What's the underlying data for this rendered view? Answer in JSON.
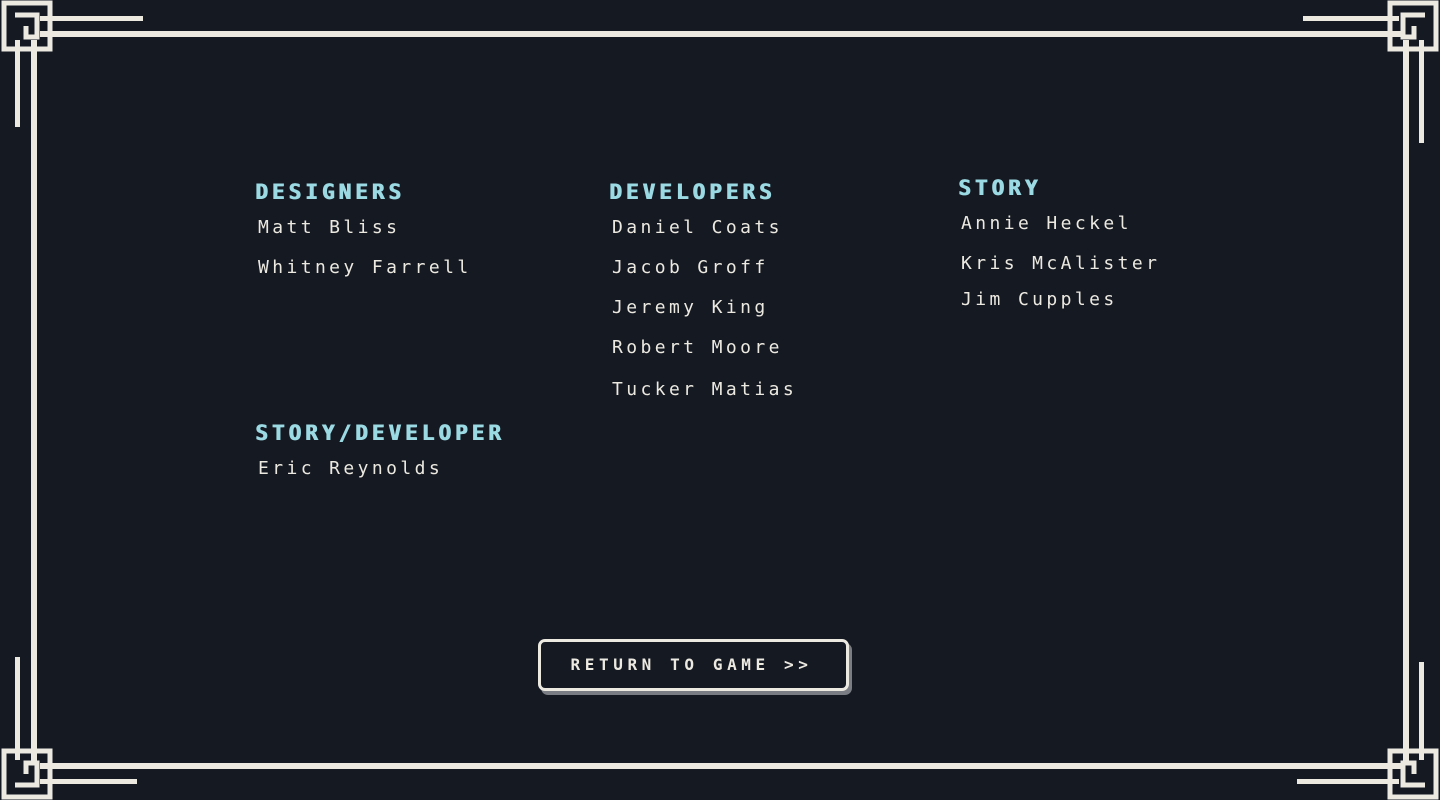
{
  "credits": {
    "designers": {
      "heading": "DESIGNERS",
      "names": [
        "Matt Bliss",
        "Whitney Farrell"
      ]
    },
    "developers": {
      "heading": "DEVELOPERS",
      "names": [
        "Daniel Coats",
        "Jacob Groff",
        "Jeremy King",
        "Robert Moore",
        "Tucker Matias"
      ]
    },
    "story": {
      "heading": "STORY",
      "names": [
        "Annie Heckel",
        "Kris McAlister",
        "Jim Cupples"
      ]
    },
    "story_developer": {
      "heading": "STORY/DEVELOPER",
      "names": [
        "Eric Reynolds"
      ]
    }
  },
  "return_button": {
    "label": "RETURN TO GAME >>"
  },
  "colors": {
    "background": "#151922",
    "heading": "#9bd9e3",
    "text": "#ece9e1",
    "frame": "#ece9e1",
    "button_shadow": "#7a7d83"
  }
}
